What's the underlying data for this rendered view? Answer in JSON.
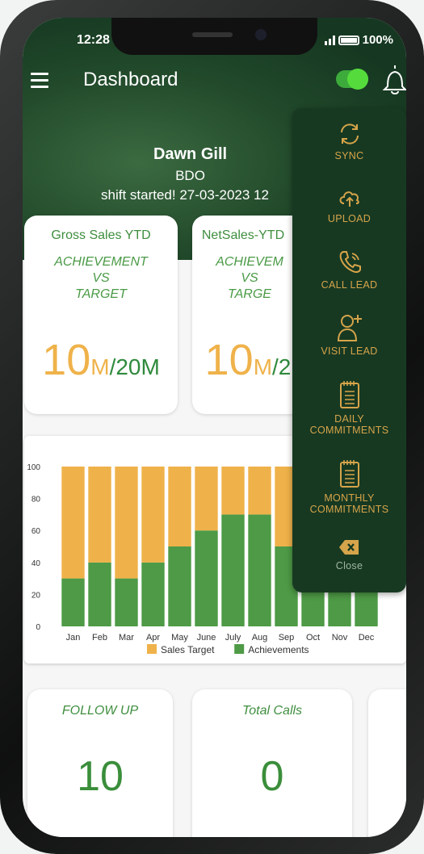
{
  "status_bar": {
    "time": "12:28",
    "battery": "100%"
  },
  "header": {
    "title": "Dashboard",
    "toggle_on": true
  },
  "profile": {
    "name": "Dawn Gill",
    "role": "BDO",
    "shift_label": "shift started!",
    "shift_date": "27-03-2023 12"
  },
  "cards": [
    {
      "title": "Gross Sales YTD",
      "subtitle_lines": [
        "ACHIEVEMENT",
        "VS",
        "TARGET"
      ],
      "achievement": "10",
      "achievement_unit": "M",
      "target": "/20M"
    },
    {
      "title": "NetSales-YTD",
      "subtitle_lines": [
        "ACHIEVEM",
        "VS",
        "TARGE"
      ],
      "achievement": "10",
      "achievement_unit": "M",
      "target": "/2"
    }
  ],
  "chart_data": {
    "type": "bar",
    "stacked": true,
    "categories": [
      "Jan",
      "Feb",
      "Mar",
      "Apr",
      "May",
      "June",
      "July",
      "Aug",
      "Sep",
      "Oct",
      "Nov",
      "Dec"
    ],
    "series": [
      {
        "name": "Achievements",
        "color": "#4e9a46",
        "values": [
          30,
          40,
          30,
          40,
          50,
          60,
          70,
          70,
          50,
          100,
          100,
          100
        ]
      },
      {
        "name": "Sales Target",
        "color": "#efb24a",
        "values": [
          70,
          60,
          70,
          60,
          50,
          40,
          30,
          30,
          50,
          0,
          0,
          0
        ]
      }
    ],
    "ylim": [
      0,
      100
    ],
    "yticks": [
      0,
      20,
      40,
      60,
      80,
      100
    ],
    "legend_position": "bottom",
    "legend": [
      "Sales Target",
      "Achievements"
    ]
  },
  "stats": [
    {
      "title": "FOLLOW UP",
      "value": "10"
    },
    {
      "title": "Total Calls",
      "value": "0"
    }
  ],
  "side_menu": {
    "items": [
      {
        "label": "SYNC",
        "icon": "sync-icon"
      },
      {
        "label": "UPLOAD",
        "icon": "cloud-upload-icon"
      },
      {
        "label": "CALL LEAD",
        "icon": "phone-icon"
      },
      {
        "label": "VISIT LEAD",
        "icon": "add-user-icon"
      },
      {
        "label_lines": [
          "DAILY",
          "COMMITMENTS"
        ],
        "icon": "notepad-icon"
      },
      {
        "label_lines": [
          "MONTHLY",
          "COMMITMENTS"
        ],
        "icon": "notepad-icon"
      },
      {
        "label": "Close",
        "icon": "close-backspace-icon"
      }
    ],
    "accent": "#d6a44a",
    "background": "#173922"
  }
}
